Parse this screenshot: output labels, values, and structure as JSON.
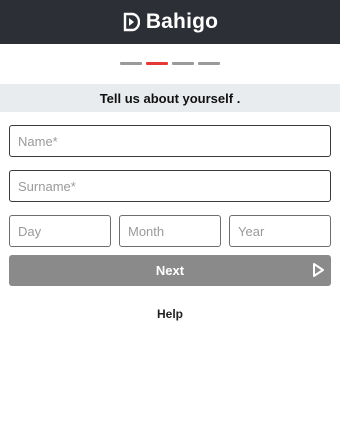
{
  "app": {
    "brand": "Bahigo"
  },
  "progress": {
    "total_steps": 4,
    "current_step": 2
  },
  "banner": {
    "text": "Tell us about yourself ."
  },
  "form": {
    "name_placeholder": "Name*",
    "surname_placeholder": "Surname*",
    "day_placeholder": "Day",
    "month_placeholder": "Month",
    "year_placeholder": "Year",
    "next_label": "Next"
  },
  "footer": {
    "help_label": "Help"
  },
  "colors": {
    "header_bg": "#2c2f36",
    "active_step": "#e53935",
    "inactive_step": "#9a9a9a",
    "banner_bg": "#e8ecef",
    "button_bg": "#8a8a8a"
  }
}
